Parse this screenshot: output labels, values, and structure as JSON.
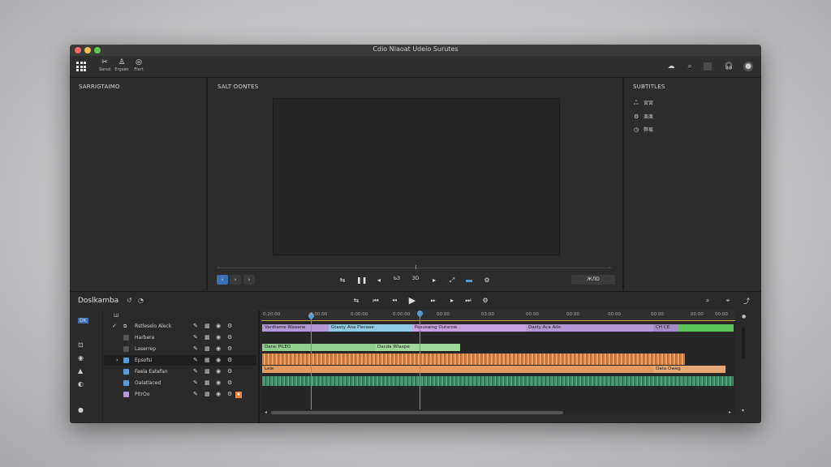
{
  "window": {
    "title": "Cdio Nlaoat Udeio Surutes"
  },
  "toolbar": {
    "tools": [
      {
        "label": "Sarsd",
        "icon": "scissors-icon"
      },
      {
        "label": "Ergsen",
        "icon": "person-icon"
      },
      {
        "label": "Flert",
        "icon": "effects-icon"
      }
    ]
  },
  "panels": {
    "left": {
      "title": "SARRIGTAIMO"
    },
    "center": {
      "title": "SALT OONTES"
    },
    "right": {
      "title": "SUBTITLES",
      "items": [
        {
          "label": "宮宮",
          "icon": "people-icon"
        },
        {
          "label": "楽楽",
          "icon": "settings-icon"
        },
        {
          "label": "弊易",
          "icon": "clock-icon"
        }
      ]
    }
  },
  "preview": {
    "nav_prev": "‹",
    "nav_next": "›",
    "nav_more": "›",
    "timecode_btn": "ЖЛD",
    "time_a": "ЬЗ",
    "time_b": "ЗD"
  },
  "timeline": {
    "title": "Doslkamba",
    "tool_label": "Ш",
    "side_label": "DK",
    "ruler_labels": [
      "0:20:00",
      "0:00:00",
      "0:00:00",
      "0:00:00",
      "00:00",
      "03:00",
      "00:00",
      "00:00",
      "00:00",
      "00:00",
      "00:00",
      "00:00"
    ],
    "tracks": [
      {
        "name": "Rstleselo Aleck",
        "checked": true
      },
      {
        "name": "Harbera"
      },
      {
        "name": "Laserrep"
      },
      {
        "name": "Epsofsi"
      },
      {
        "name": "Faela Eatefan"
      },
      {
        "name": "Oalatlaced"
      },
      {
        "name": "PitrOo"
      }
    ],
    "clips": {
      "row1": [
        "Vardtame Waaane",
        "Gtasty Ana Pleraae",
        "Pesusaing Outsrow",
        "Dasty Aca Ado",
        "CH CE"
      ],
      "row2": [
        "Darai PILEO",
        "Dacda Wlaxpe"
      ],
      "row3": [
        "Lele"
      ],
      "row4": [
        "Data Oweg"
      ]
    }
  },
  "colors": {
    "accent": "#5b9bd5",
    "clip_purple": "#b497d6",
    "clip_blue": "#8ecae6",
    "clip_green": "#8ed08b",
    "clip_orange": "#e39b62",
    "audio_green": "#3f8f6b"
  }
}
